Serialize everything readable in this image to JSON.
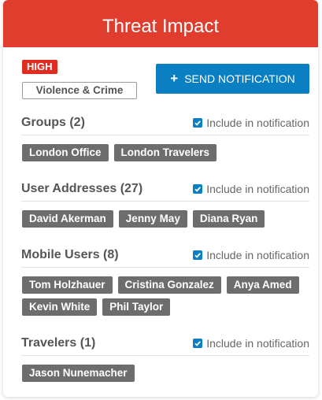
{
  "header": {
    "title": "Threat Impact"
  },
  "threat": {
    "severity": "HIGH",
    "category": "Violence & Crime"
  },
  "actions": {
    "send_label": "SEND NOTIFICATION",
    "send_icon": "plus-icon"
  },
  "include_label": "Include in notification",
  "colors": {
    "header": "#e03d2f",
    "severity": "#df2c21",
    "button": "#0a7fc2",
    "tag": "#6d6d6d"
  },
  "sections": [
    {
      "title": "Groups",
      "count": "(2)",
      "included": true,
      "tags": [
        "London Office",
        "London Travelers"
      ]
    },
    {
      "title": "User Addresses",
      "count": "(27)",
      "included": true,
      "tags": [
        "David Akerman",
        "Jenny May",
        "Diana Ryan"
      ]
    },
    {
      "title": "Mobile Users",
      "count": "(8)",
      "included": true,
      "tags": [
        "Tom Holzhauer",
        "Cristina Gonzalez",
        "Anya Amed",
        "Kevin White",
        "Phil Taylor"
      ]
    },
    {
      "title": "Travelers",
      "count": "(1)",
      "included": true,
      "tags": [
        "Jason Nunemacher"
      ]
    }
  ]
}
